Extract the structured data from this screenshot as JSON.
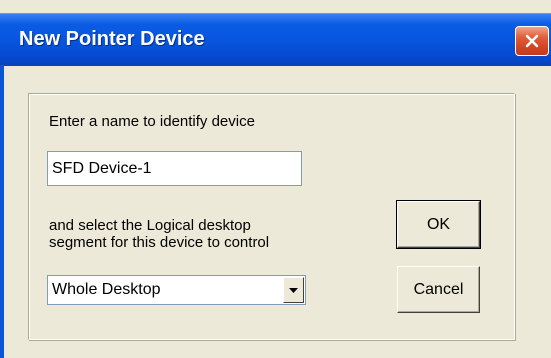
{
  "window": {
    "title": "New Pointer Device"
  },
  "form": {
    "name_prompt": "Enter a name to identify device",
    "name_value": "SFD Device-1",
    "segment_prompt_line1": "and select the Logical desktop",
    "segment_prompt_line2": "segment for this device to control",
    "segment_selected": "Whole Desktop"
  },
  "buttons": {
    "ok_label": "OK",
    "cancel_label": "Cancel"
  },
  "icons": {
    "close": "close-icon",
    "dropdown": "chevron-down-icon"
  }
}
